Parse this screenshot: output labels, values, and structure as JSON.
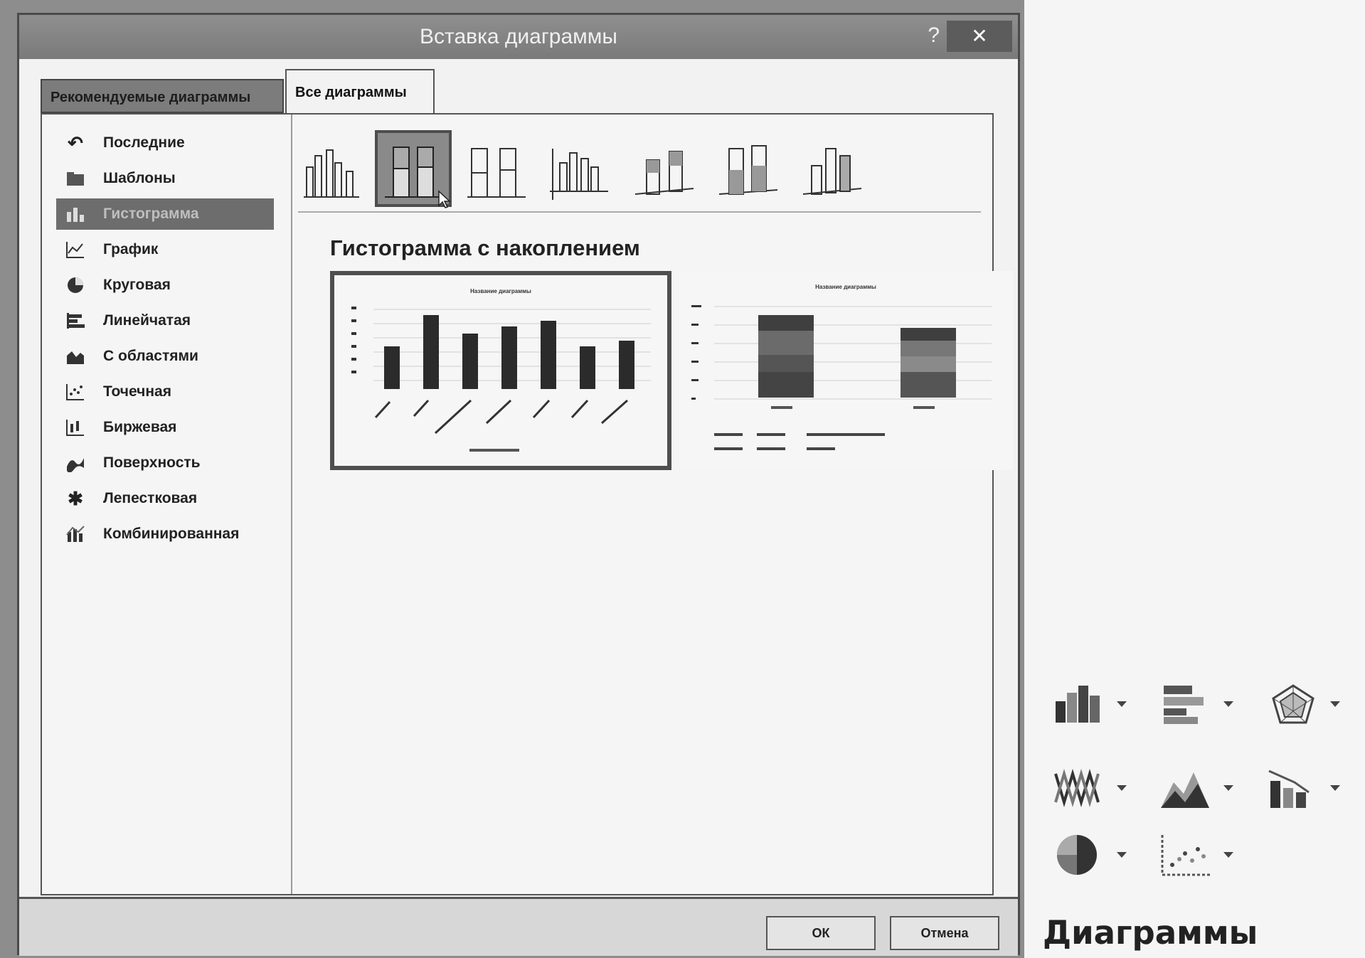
{
  "dialog": {
    "title": "Вставка диаграммы",
    "help_label": "?",
    "close_label": "✕",
    "tabs": [
      {
        "label": "Рекомендуемые диаграммы"
      },
      {
        "label": "Все диаграммы"
      }
    ],
    "categories": [
      {
        "label": "Последние",
        "icon": "undo-icon"
      },
      {
        "label": "Шаблоны",
        "icon": "folder-icon"
      },
      {
        "label": "Гистограмма",
        "icon": "column-chart-icon"
      },
      {
        "label": "График",
        "icon": "line-chart-icon"
      },
      {
        "label": "Круговая",
        "icon": "pie-chart-icon"
      },
      {
        "label": "Линейчатая",
        "icon": "bar-chart-icon"
      },
      {
        "label": "С областями",
        "icon": "area-chart-icon"
      },
      {
        "label": "Точечная",
        "icon": "scatter-chart-icon"
      },
      {
        "label": "Биржевая",
        "icon": "stock-chart-icon"
      },
      {
        "label": "Поверхность",
        "icon": "surface-chart-icon"
      },
      {
        "label": "Лепестковая",
        "icon": "radar-chart-icon"
      },
      {
        "label": "Комбинированная",
        "icon": "combo-chart-icon"
      }
    ],
    "selected_subtype_name": "Гистограмма с накоплением",
    "preview_chart_title": "Название диаграммы",
    "ok_label": "ОК",
    "cancel_label": "Отмена"
  },
  "panel": {
    "label": "Диаграммы"
  }
}
